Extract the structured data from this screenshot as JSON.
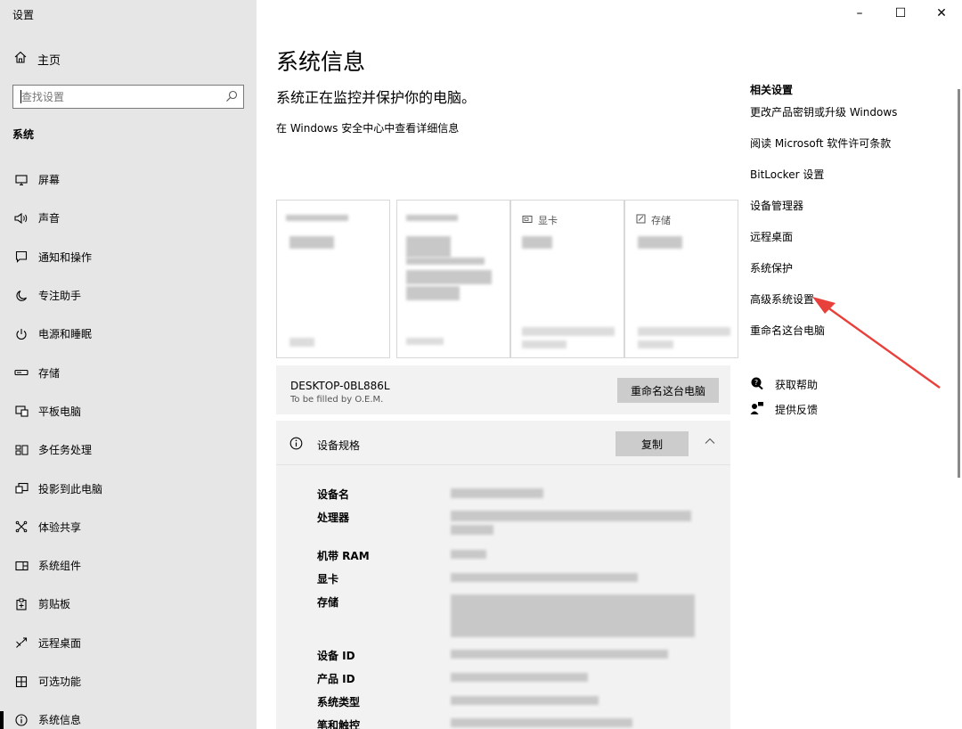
{
  "window": {
    "title": "设置",
    "minimize": "–",
    "maximize": "☐",
    "close": "✕"
  },
  "sidebar": {
    "home_label": "主页",
    "search_placeholder": "查找设置",
    "section_label": "系统",
    "items": [
      {
        "label": "屏幕",
        "icon": "monitor-icon"
      },
      {
        "label": "声音",
        "icon": "speaker-icon"
      },
      {
        "label": "通知和操作",
        "icon": "notification-icon"
      },
      {
        "label": "专注助手",
        "icon": "moon-icon"
      },
      {
        "label": "电源和睡眠",
        "icon": "power-icon"
      },
      {
        "label": "存储",
        "icon": "storage-icon"
      },
      {
        "label": "平板电脑",
        "icon": "tablet-icon"
      },
      {
        "label": "多任务处理",
        "icon": "multitask-icon"
      },
      {
        "label": "投影到此电脑",
        "icon": "project-icon"
      },
      {
        "label": "体验共享",
        "icon": "share-icon"
      },
      {
        "label": "系统组件",
        "icon": "components-icon"
      },
      {
        "label": "剪贴板",
        "icon": "clipboard-icon"
      },
      {
        "label": "远程桌面",
        "icon": "remote-desktop-icon"
      },
      {
        "label": "可选功能",
        "icon": "optional-features-icon"
      },
      {
        "label": "系统信息",
        "icon": "info-icon",
        "active": true
      }
    ]
  },
  "main": {
    "title": "系统信息",
    "subtitle": "系统正在监控并保护你的电脑。",
    "security_link": "在 Windows 安全中心中查看详细信息",
    "cards": [
      {
        "label": ""
      },
      {
        "label": ""
      },
      {
        "label": "显卡",
        "icon": "gpu-icon"
      },
      {
        "label": "存储",
        "icon": "storage-icon"
      }
    ],
    "device": {
      "name": "DESKTOP-0BL886L",
      "sub": "To be filled by O.E.M.",
      "rename_button": "重命名这台电脑"
    },
    "specs": {
      "title": "设备规格",
      "copy_button": "复制",
      "rows": [
        "设备名",
        "处理器",
        "机带 RAM",
        "显卡",
        "存储",
        "设备 ID",
        "产品 ID",
        "系统类型",
        "笔和触控"
      ]
    }
  },
  "related": {
    "title": "相关设置",
    "links": [
      "更改产品密钥或升级 Windows",
      "阅读 Microsoft 软件许可条款",
      "BitLocker 设置",
      "设备管理器",
      "远程桌面",
      "系统保护",
      "高级系统设置",
      "重命名这台电脑"
    ]
  },
  "help": {
    "items": [
      {
        "label": "获取帮助",
        "icon": "help-chat-icon"
      },
      {
        "label": "提供反馈",
        "icon": "feedback-icon"
      }
    ]
  },
  "colors": {
    "sidebar_bg": "#e6e6e6",
    "button_bg": "#cccccc",
    "panel_bg": "#f2f2f2",
    "annotation_arrow": "#e8413c"
  }
}
